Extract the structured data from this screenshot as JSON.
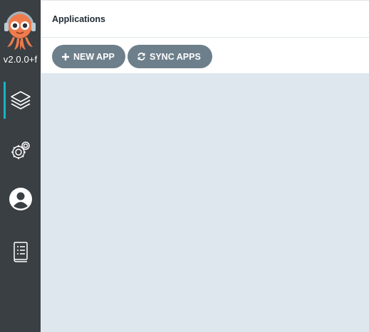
{
  "sidebar": {
    "version": "v2.0.0+f",
    "items": [
      {
        "name": "applications",
        "icon": "layers-icon",
        "active": true
      },
      {
        "name": "settings",
        "icon": "gear-icon",
        "active": false
      },
      {
        "name": "user-info",
        "icon": "user-icon",
        "active": false
      },
      {
        "name": "documentation",
        "icon": "docs-icon",
        "active": false
      }
    ]
  },
  "header": {
    "title": "Applications"
  },
  "toolbar": {
    "new_app_label": "NEW APP",
    "sync_apps_label": "SYNC APPS"
  },
  "colors": {
    "sidebar_bg": "#3a3f43",
    "active_indicator": "#17b3c2",
    "button_bg": "#6d7f8b",
    "content_bg": "#dee6ee",
    "logo_orange": "#ef7b4d"
  }
}
